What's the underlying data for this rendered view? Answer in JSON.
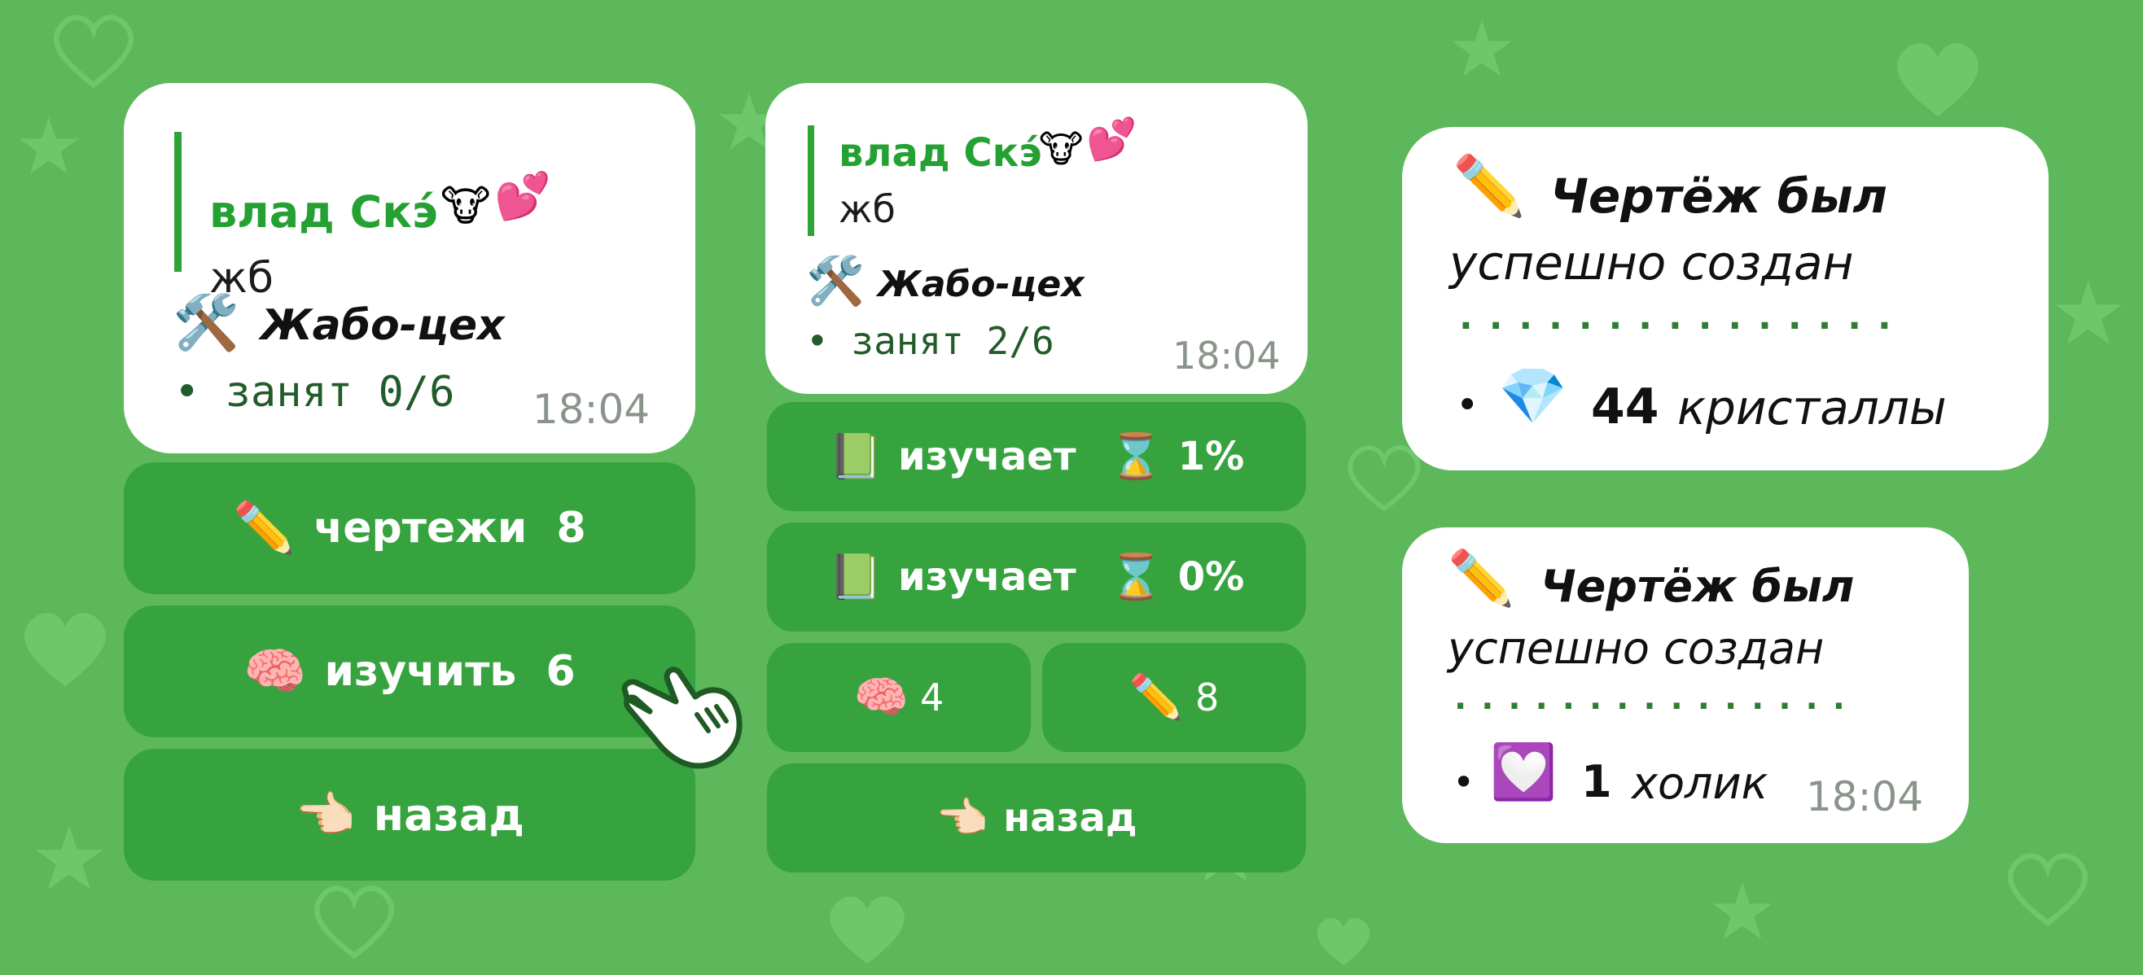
{
  "colors": {
    "background": "#5cb85a",
    "button": "#36a33f",
    "accent_author": "#25a133",
    "quote_bar": "#2fa336"
  },
  "left_message": {
    "reply_author": "влад Скэ́",
    "reply_text": "жб",
    "workshop_title": "Жабо-цех",
    "status": "• занят 0/6",
    "time": "18:04",
    "buttons": {
      "drawings": "чертежи  8",
      "study": "изучить  6",
      "back": "назад"
    }
  },
  "middle_message": {
    "reply_author": "влад Скэ́",
    "reply_text": "жб",
    "workshop_title": "Жабо-цех",
    "status": "• занят 2/6",
    "time": "18:04",
    "buttons": {
      "studying_1": "изучает",
      "progress_1": "1%",
      "studying_2": "изучает",
      "progress_2": "0%",
      "brain_count": "4",
      "pencil_count": "8",
      "back": "назад"
    }
  },
  "result_messages": [
    {
      "title": "Чертёж был",
      "subtitle": "успешно создан",
      "dots": "...............",
      "bullet": "•",
      "amount": "44",
      "item": "кристаллы",
      "icon": "gem-icon"
    },
    {
      "title": "Чертёж был",
      "subtitle": "успешно создан",
      "dots": "...............",
      "bullet": "•",
      "amount": "1",
      "item": "холик",
      "time": "18:04",
      "icon": "purple-heart-icon"
    }
  ]
}
